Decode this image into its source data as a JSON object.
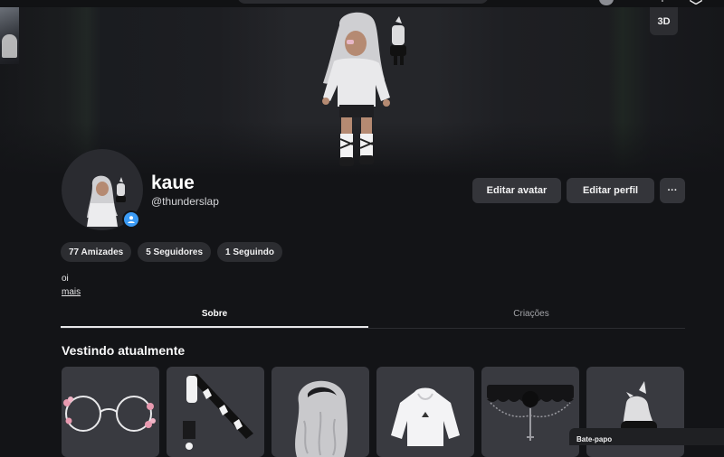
{
  "profile": {
    "display_name": "kaue",
    "username": "@thunderslap",
    "bio": "oi",
    "more_link": "mais"
  },
  "viewer": {
    "toggle_3d": "3D"
  },
  "actions": {
    "edit_avatar": "Editar avatar",
    "edit_profile": "Editar perfil",
    "more": "···"
  },
  "stats": {
    "friends": "77 Amizades",
    "followers": "5 Seguidores",
    "following": "1 Seguindo"
  },
  "tabs": {
    "about": "Sobre",
    "creations": "Criações"
  },
  "wearing": {
    "title": "Vestindo atualmente",
    "items": [
      {
        "icon": "glasses-icon"
      },
      {
        "icon": "bat-icon"
      },
      {
        "icon": "hair-icon"
      },
      {
        "icon": "hoodie-icon"
      },
      {
        "icon": "choker-icon"
      },
      {
        "icon": "horns-icon"
      }
    ]
  },
  "chat": {
    "label": "Bate-papo"
  },
  "colors": {
    "background": "#131417",
    "button": "#34353a",
    "chip": "#2c2d31",
    "online_badge": "#3b9bf5"
  }
}
